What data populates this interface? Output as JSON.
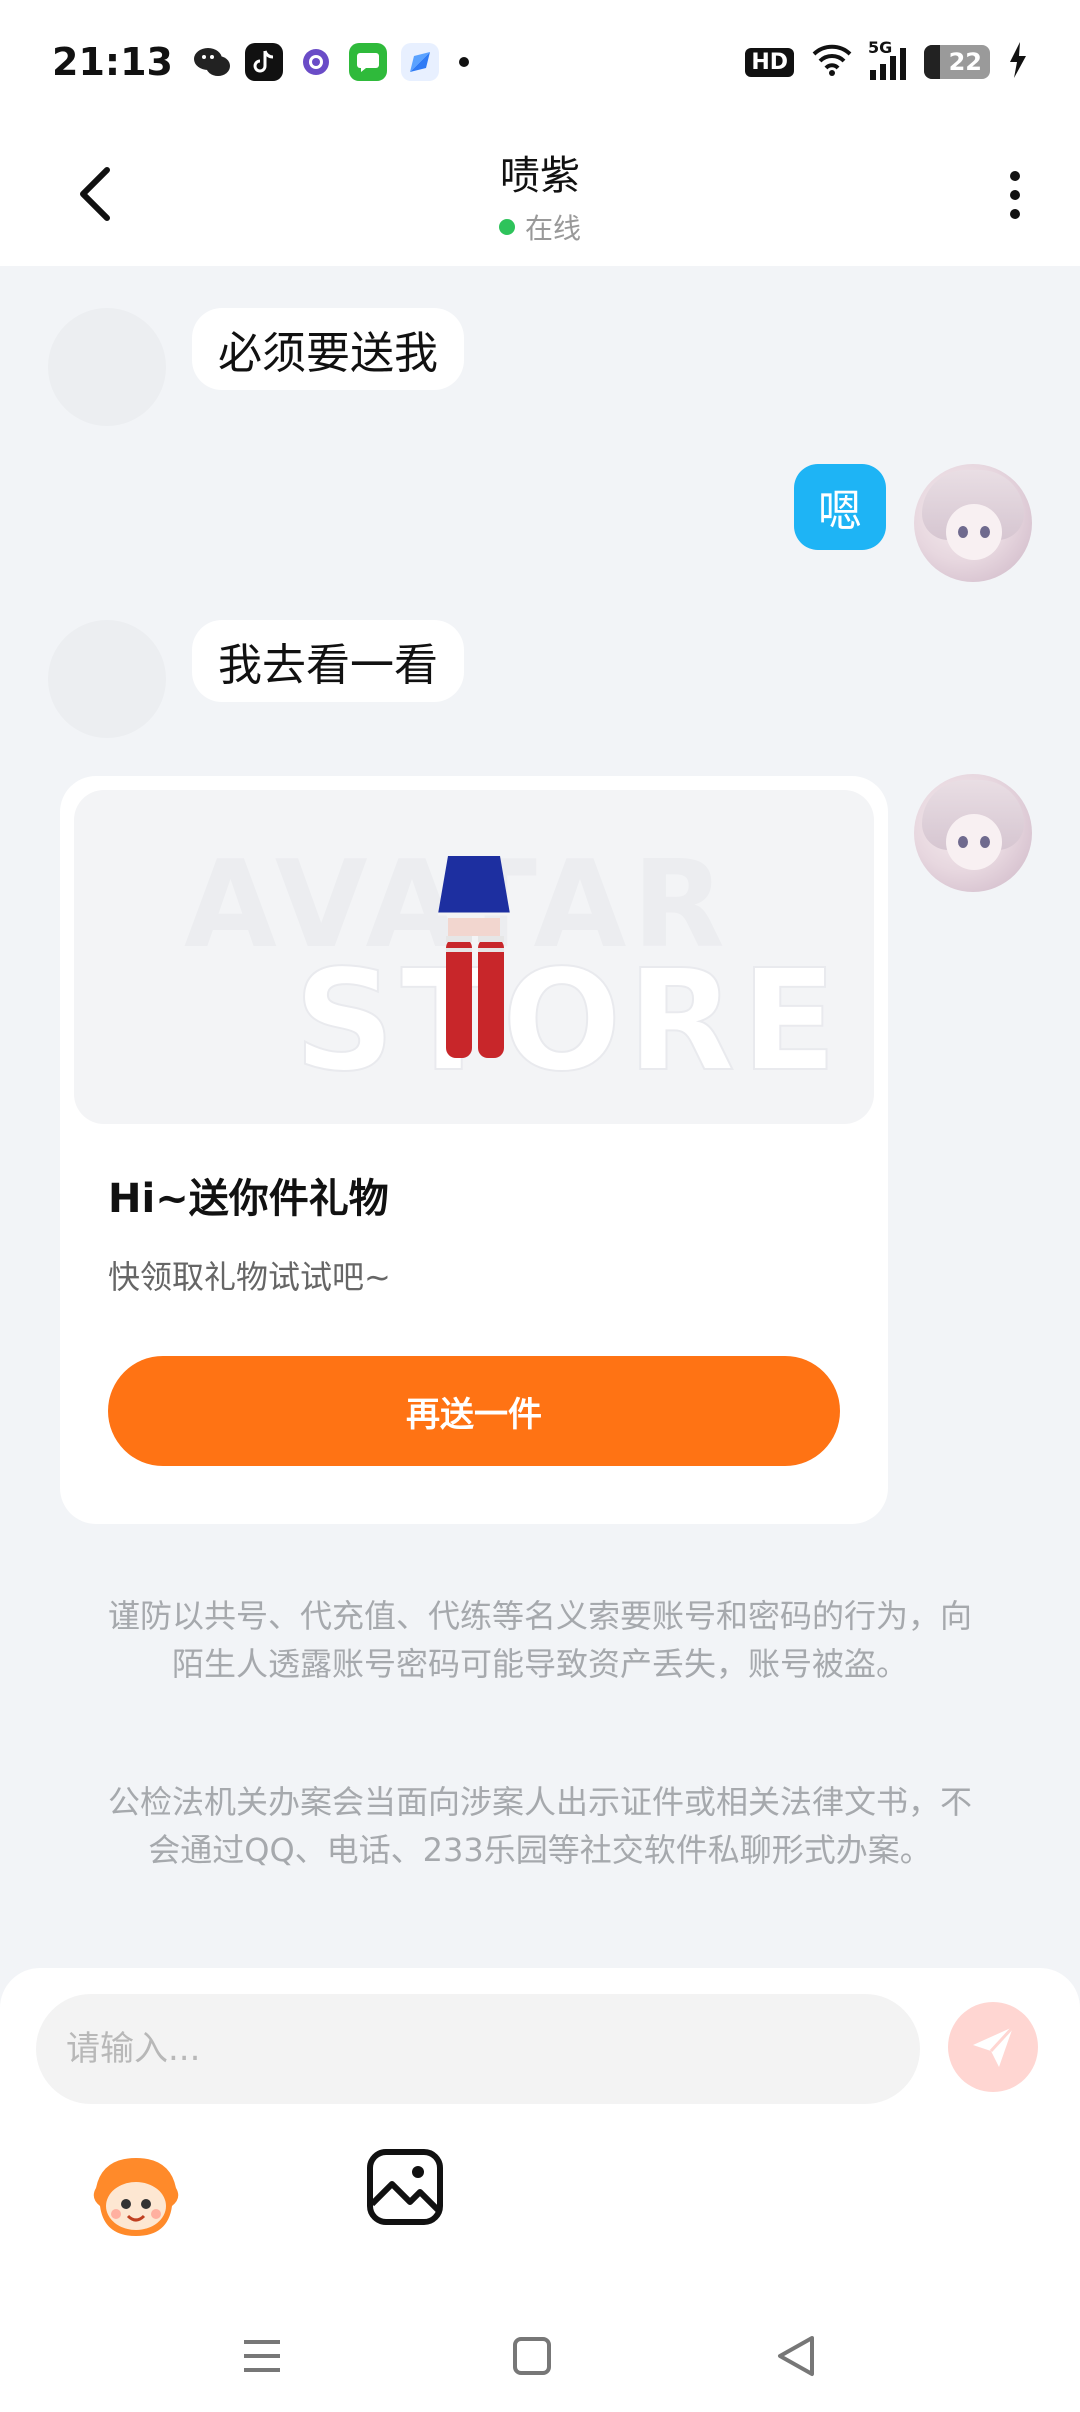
{
  "status_bar": {
    "time": "21:13",
    "network_badge": "HD",
    "network_type": "5G",
    "battery_level": "22",
    "apps": [
      "wechat-icon",
      "tiktok-icon",
      "purple-app-icon",
      "messages-icon",
      "blue-app-icon"
    ]
  },
  "header": {
    "title": "啧紫",
    "status": "在线",
    "status_color": "#2ec35b"
  },
  "messages": [
    {
      "side": "them",
      "text": "必须要送我"
    },
    {
      "side": "me",
      "text": "嗯"
    },
    {
      "side": "them",
      "text": "我去看一看"
    }
  ],
  "gift_card": {
    "watermark_line1": "AVATAR",
    "watermark_line2": "STORE",
    "title": "Hi~送你件礼物",
    "subtitle": "快领取礼物试试吧~",
    "button_label": "再送一件",
    "button_color": "#ff7314"
  },
  "notices": [
    "谨防以共号、代充值、代练等名义索要账号和密码的行为，向陌生人透露账号密码可能导致资产丢失，账号被盗。",
    "公检法机关办案会当面向涉案人出示证件或相关法律文书，不会通过QQ、电话、233乐园等社交软件私聊形式办案。"
  ],
  "composer": {
    "placeholder": "请输入...",
    "send_color": "#ffd6d2"
  },
  "accent": {
    "self_bubble": "#1eb4f5",
    "page_bg": "#f2f4f7"
  }
}
